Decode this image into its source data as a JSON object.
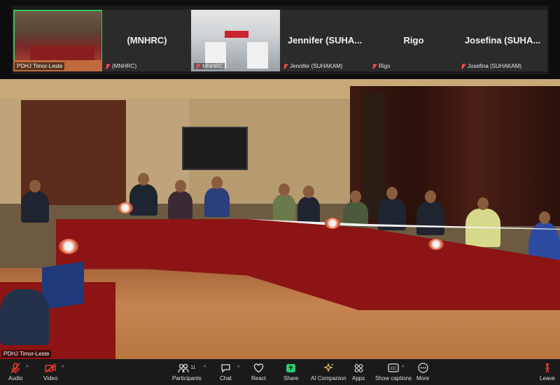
{
  "participants_strip": [
    {
      "big_name": "",
      "small_name": "PDHJ Timor-Leste",
      "has_video": true,
      "active": true
    },
    {
      "big_name": "(MNHRC)",
      "small_name": "(MNHRC)",
      "has_video": false
    },
    {
      "big_name": "",
      "small_name": "MNHRC",
      "has_video": true
    },
    {
      "big_name": "Jennifer (SUHA...",
      "small_name": "Jennifer (SUHAKAM)",
      "has_video": false
    },
    {
      "big_name": "Rigo",
      "small_name": "Rigo",
      "has_video": false
    },
    {
      "big_name": "Josefina (SUHA...",
      "small_name": "Josefina (SUHAKAM)",
      "has_video": false
    }
  ],
  "main_video": {
    "label": "PDHJ Timor-Leste"
  },
  "toolbar": {
    "audio": "Audio",
    "video": "Video",
    "participants": "Participants",
    "participants_count": "11",
    "chat": "Chat",
    "react": "React",
    "share": "Share",
    "ai_companion": "AI Companion",
    "apps": "Apps",
    "show_captions": "Show captions",
    "more": "More",
    "leave": "Leave"
  },
  "icons": {
    "audio": "microphone-muted-icon",
    "video": "camera-off-icon",
    "participants": "people-icon",
    "chat": "chat-bubble-icon",
    "react": "heart-icon",
    "share": "share-arrow-icon",
    "ai_companion": "sparkle-icon",
    "apps": "apps-icon",
    "show_captions": "cc-icon",
    "more": "ellipsis-icon",
    "leave": "leave-icon"
  },
  "colors": {
    "active_border": "#34c759",
    "muted": "#ff3b30",
    "share": "#2ecc71"
  }
}
